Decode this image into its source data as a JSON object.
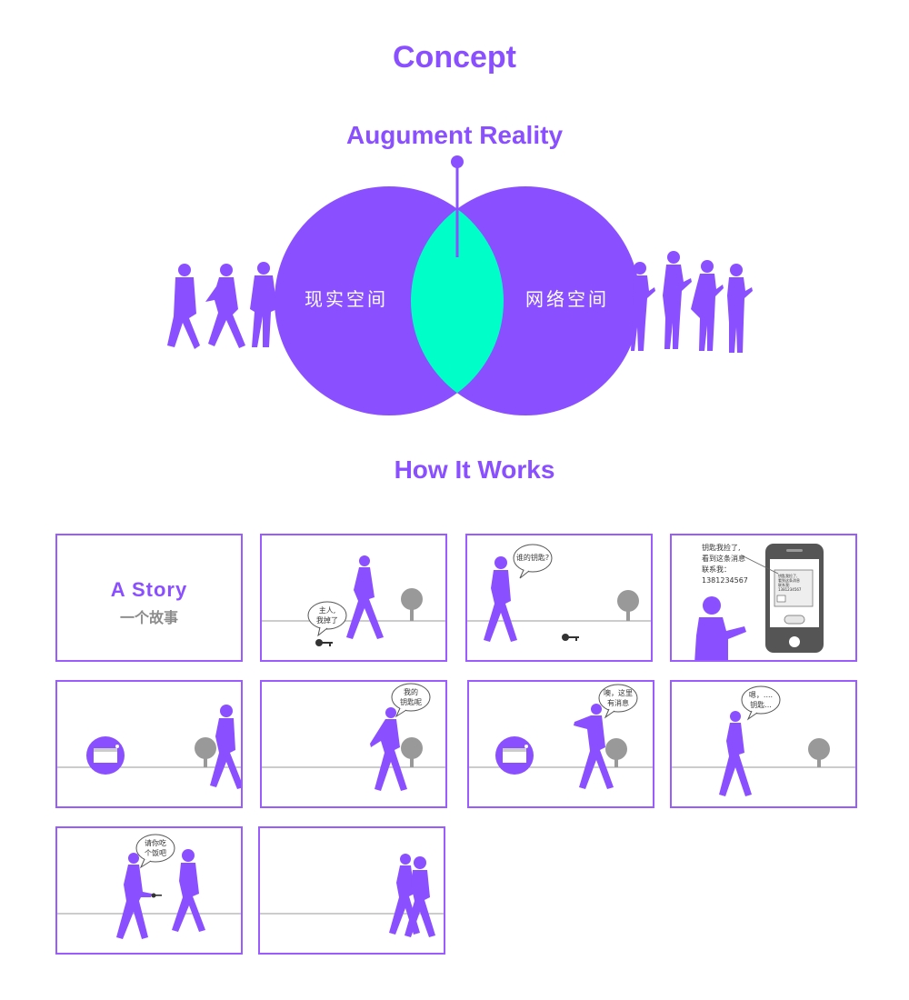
{
  "colors": {
    "purple": "#8a4fff",
    "mint": "#00ffc8",
    "gray": "#8c8c8c"
  },
  "concept": {
    "title": "Concept",
    "subtitle": "Augument Reality",
    "left_label": "现实空间",
    "right_label": "网络空间"
  },
  "how": {
    "title": "How It Works",
    "story_title": "A  Story",
    "story_sub": "一个故事",
    "bubbles": {
      "p2": "主人,\n我掉了",
      "p3": "谁的钥匙?",
      "p6": "我的\n钥匙呢",
      "p7": "噢，这里\n有消息",
      "p8": "嗯，....\n钥匙...",
      "p9": "请你吃\n个饭吧"
    },
    "p4_note": "钥匙我捡了,\n看到这条消息\n联系我：\n1381234567",
    "p4_screen": "钥匙我捡了,\n看到这条消息\n联系我:\n1381234567"
  }
}
